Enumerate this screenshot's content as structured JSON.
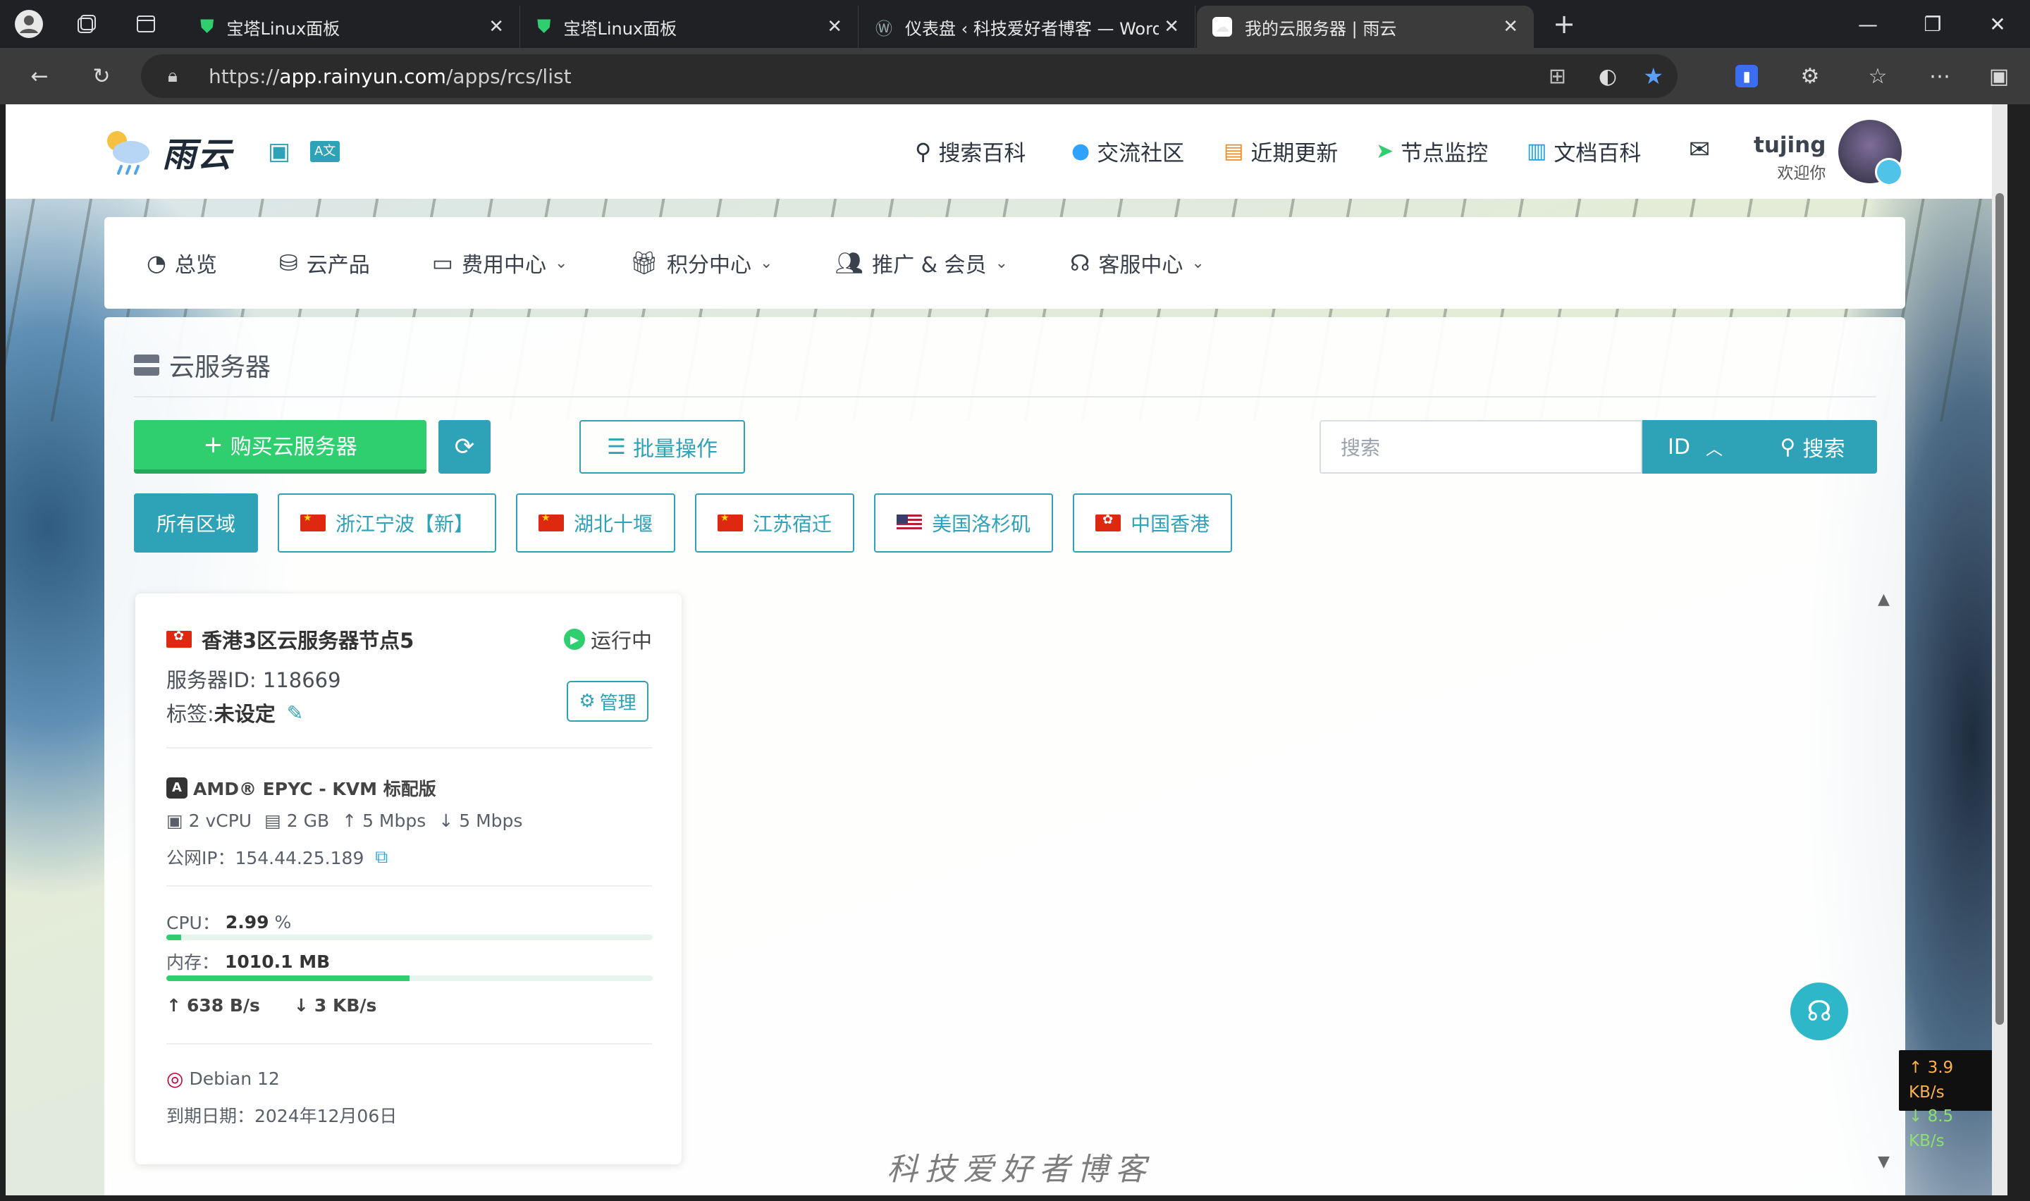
{
  "browser": {
    "tabs": [
      {
        "title": "宝塔Linux面板"
      },
      {
        "title": "宝塔Linux面板"
      },
      {
        "title": "仪表盘 ‹ 科技爱好者博客 — Word"
      },
      {
        "title": "我的云服务器 | 雨云"
      }
    ],
    "url_prefix": "https://",
    "url_host": "app.rainyun.com",
    "url_path": "/apps/rcs/list"
  },
  "site": {
    "logo_text": "雨云",
    "nav": [
      {
        "label": "搜索百科",
        "icon": "search-icon",
        "color": "#3d4450"
      },
      {
        "label": "交流社区",
        "icon": "qq-icon",
        "color": "#2ea2ff"
      },
      {
        "label": "近期更新",
        "icon": "news-icon",
        "color": "#f08a24"
      },
      {
        "label": "节点监控",
        "icon": "send-icon",
        "color": "#2fce6f"
      },
      {
        "label": "文档百科",
        "icon": "book-icon",
        "color": "#1aa3e8"
      }
    ],
    "user": {
      "name": "tujing",
      "greeting": "欢迎你"
    }
  },
  "menu": [
    {
      "label": "总览",
      "icon": "dashboard-icon",
      "has_dropdown": false
    },
    {
      "label": "云产品",
      "icon": "cubes-icon",
      "has_dropdown": false
    },
    {
      "label": "费用中心",
      "icon": "money-icon",
      "has_dropdown": true
    },
    {
      "label": "积分中心",
      "icon": "gift-icon",
      "has_dropdown": true
    },
    {
      "label": "推广 & 会员",
      "icon": "users-icon",
      "has_dropdown": true
    },
    {
      "label": "客服中心",
      "icon": "headset-icon",
      "has_dropdown": true
    }
  ],
  "panel": {
    "title": "云服务器",
    "buy_label": "购买云服务器",
    "batch_label": "批量操作",
    "search_placeholder": "搜索",
    "search_type": "ID",
    "search_label": "搜索",
    "regions": [
      {
        "label": "所有区域",
        "flag": "",
        "active": true
      },
      {
        "label": "浙江宁波【新】",
        "flag": "cn",
        "active": false
      },
      {
        "label": "湖北十堰",
        "flag": "cn",
        "active": false
      },
      {
        "label": "江苏宿迁",
        "flag": "cn",
        "active": false
      },
      {
        "label": "美国洛杉矶",
        "flag": "us",
        "active": false
      },
      {
        "label": "中国香港",
        "flag": "hk",
        "active": false
      }
    ]
  },
  "server": {
    "name": "香港3区云服务器节点5",
    "status": "运行中",
    "id_line": "服务器ID: 118669",
    "tag_prefix": "标签: ",
    "tag_value": "未设定",
    "manage_label": "管理",
    "cpu_model": "AMD® EPYC - KVM 标配版",
    "vcpu": "2 vCPU",
    "ram": "2 GB",
    "up_bw": "5 Mbps",
    "down_bw": "5 Mbps",
    "ip_line": "公网IP：154.44.25.189",
    "cpu_label": "CPU：",
    "cpu_value": "2.99",
    "cpu_unit": "%",
    "cpu_fraction": 0.0299,
    "mem_label": "内存：",
    "mem_value": "1010.1 MB",
    "mem_fraction": 0.5,
    "net_up": "638 B/s",
    "net_down": "3 KB/s",
    "os": "Debian 12",
    "expiry": "到期日期：2024年12月06日"
  },
  "watermark": "科技爱好者博客",
  "netmon": {
    "up": "↑ 3.9 KB/s",
    "down": "↓ 8.5 KB/s"
  }
}
